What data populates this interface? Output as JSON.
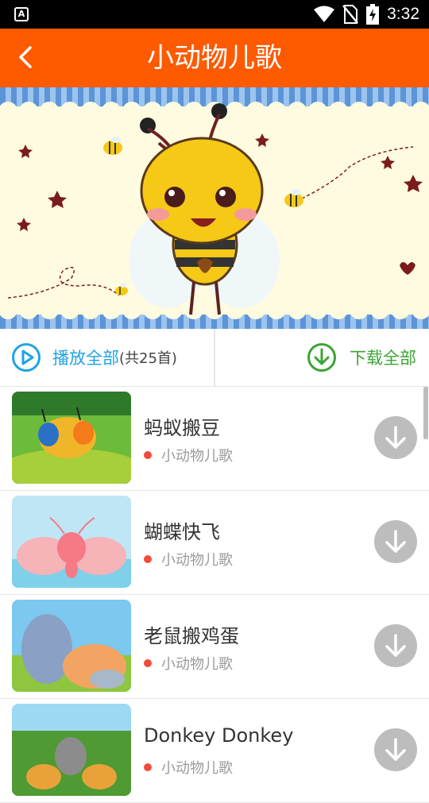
{
  "status_bar": {
    "app_icon_letter": "A",
    "time": "3:32"
  },
  "header": {
    "title": "小动物儿歌"
  },
  "actions": {
    "play_all_label": "播放全部",
    "count_label": "(共25首)",
    "download_all_label": "下载全部"
  },
  "songs": [
    {
      "title": "蚂蚁搬豆",
      "category": "小动物儿歌"
    },
    {
      "title": "蝴蝶快飞",
      "category": "小动物儿歌"
    },
    {
      "title": "老鼠搬鸡蛋",
      "category": "小动物儿歌"
    },
    {
      "title": "Donkey Donkey",
      "category": "小动物儿歌"
    }
  ],
  "colors": {
    "app_bar": "#fe5a00",
    "play_blue": "#1fa3e5",
    "download_green": "#3aa532",
    "category_dot": "#f44a3a"
  },
  "icons": {
    "back": "chevron-left",
    "play_all": "play-circle",
    "download_all": "download-circle",
    "song_download": "download-arrow"
  }
}
